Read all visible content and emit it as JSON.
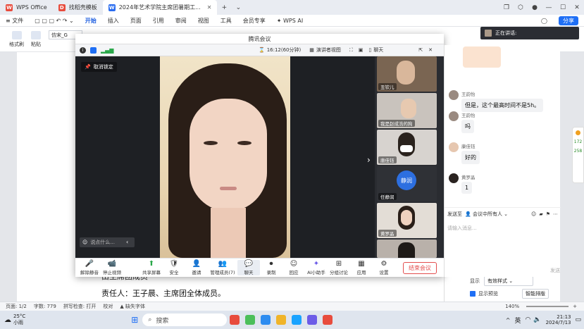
{
  "tabs": [
    {
      "label": "WPS Office",
      "color": "#e84c3d"
    },
    {
      "label": "找稻壳模板",
      "color": "#e84c3d"
    },
    {
      "label": "2024年艺术学院主席团暑期工...",
      "color": "#2b6df0"
    }
  ],
  "menu": {
    "file": "文件",
    "items": [
      "开始",
      "插入",
      "页面",
      "引用",
      "审阅",
      "视图",
      "工具",
      "会员专享"
    ],
    "wps_ai": "WPS AI",
    "share": "分享"
  },
  "ribbon": {
    "format_painter": "格式刷",
    "paste": "粘贴",
    "font_name": "仿宋_G"
  },
  "document": {
    "line1": "由主席团成员",
    "line2": "责任人：王子晨、主席团全体成员。"
  },
  "meeting": {
    "title": "腾讯会议",
    "timer": "16:12(60分钟)",
    "view_mode": "演讲者视图",
    "chat_tab": "聊天",
    "unlock": "取消锁定",
    "say_placeholder": "说点什么...",
    "participants": [
      {
        "name": "丑钦儿"
      },
      {
        "name": "我是赵成浩的狗"
      },
      {
        "name": "唐佳钰"
      },
      {
        "name": "任静润",
        "badge": "静润"
      },
      {
        "name": "黄罗晶"
      },
      {
        "name": ""
      }
    ],
    "controls": [
      {
        "label": "解除静音",
        "icon": "🎤"
      },
      {
        "label": "停止视频",
        "icon": "📹"
      },
      {
        "label": "共享屏幕",
        "icon": "⬆"
      },
      {
        "label": "安全",
        "icon": "🛡"
      },
      {
        "label": "邀请",
        "icon": "👤"
      },
      {
        "label": "管理成员(7)",
        "icon": "👥"
      },
      {
        "label": "聊天",
        "icon": "💬"
      },
      {
        "label": "录制",
        "icon": "⏺"
      },
      {
        "label": "回应",
        "icon": "☺"
      },
      {
        "label": "AI小助手",
        "icon": "✦"
      },
      {
        "label": "分组讨论",
        "icon": "⊞"
      },
      {
        "label": "应用",
        "icon": "▦"
      },
      {
        "label": "设置",
        "icon": "⚙"
      }
    ],
    "end_button": "结束会议"
  },
  "speaking": {
    "label": "正在讲话:"
  },
  "chat": {
    "messages": [
      {
        "name": "王韵怡",
        "text": "但是，这个最高时间不是5h。"
      },
      {
        "name": "王韵怡",
        "text": "吗"
      },
      {
        "name": "康佳钰",
        "text": "好的"
      },
      {
        "name": "黄罗晶",
        "text": "1"
      }
    ],
    "send_to_label": "发送至",
    "send_to_target": "会议中所有人",
    "input_placeholder": "请输入消息...",
    "send_button": "发送"
  },
  "taskpane": {
    "display_label": "显示",
    "display_value": "有效样式",
    "preview_label": "显示预览",
    "smart_sort": "智能排版"
  },
  "statusbar": {
    "page": "页面: 1/2",
    "words": "字数: 779",
    "spell": "拼写检查: 打开",
    "proof": "校对",
    "missing_font": "缺失字体",
    "zoom": "140%"
  },
  "taskbar": {
    "weather_temp": "25°C",
    "weather_desc": "小雨",
    "search": "搜索",
    "ime": "英",
    "time": "21:13",
    "date": "2024/7/13"
  },
  "side_widget": {
    "top": "172",
    "bottom": "258"
  }
}
